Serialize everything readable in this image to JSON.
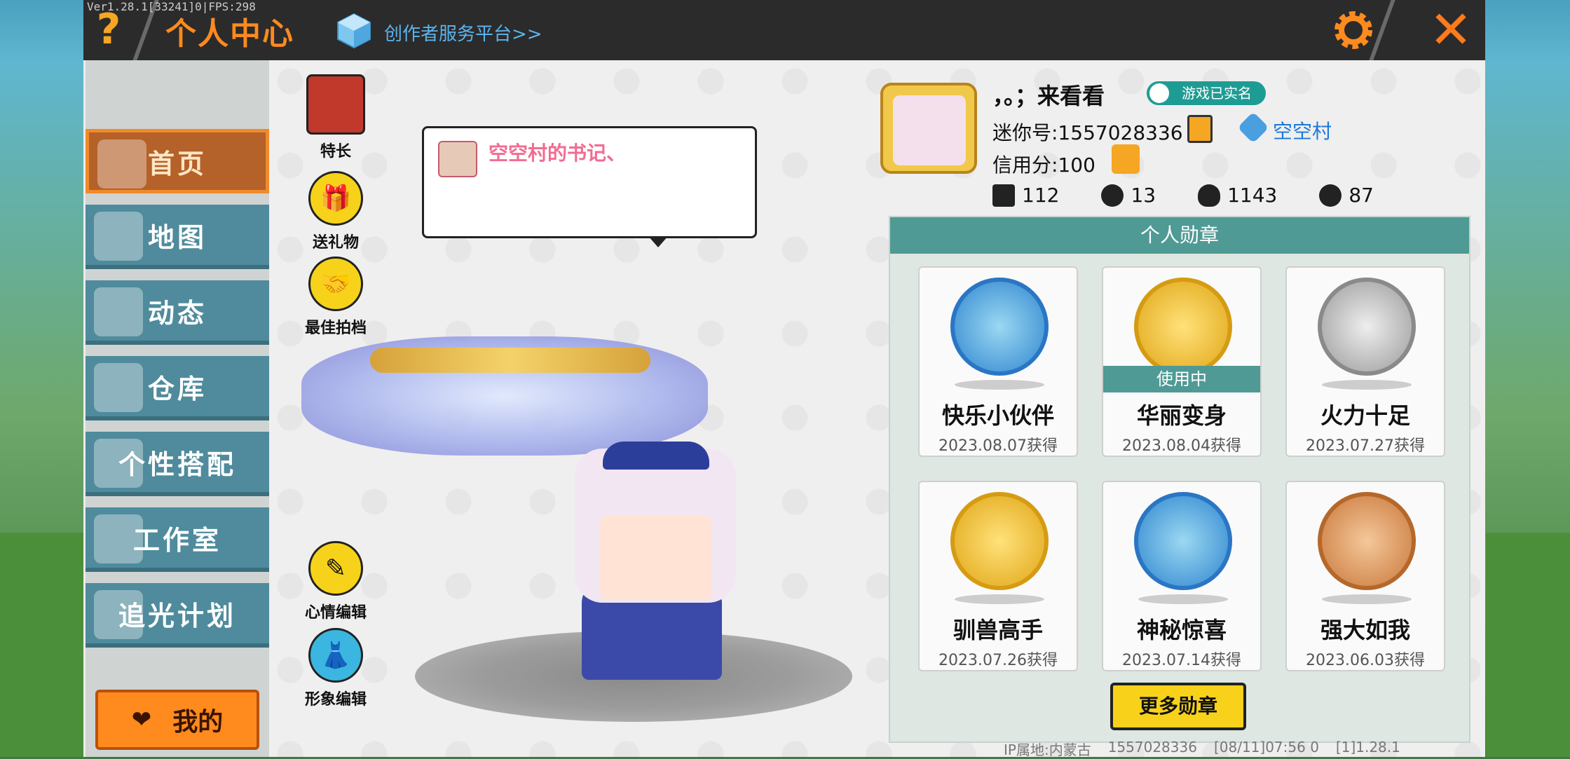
{
  "version_text": "Ver1.28.1[33241]0|FPS:298",
  "header": {
    "help_label": "?",
    "title": "个人中心",
    "creator_link": "创作者服务平台>>",
    "close_label": "✕"
  },
  "nav": {
    "items": [
      {
        "label": "首页",
        "active": true
      },
      {
        "label": "地图"
      },
      {
        "label": "动态"
      },
      {
        "label": "仓库"
      },
      {
        "label": "个性搭配"
      },
      {
        "label": "工作室"
      },
      {
        "label": "追光计划"
      }
    ],
    "mine_label": "我的"
  },
  "side_buttons": {
    "specialty": "特长",
    "gift": "送礼物",
    "partner": "最佳拍档",
    "mood_edit": "心情编辑",
    "image_edit": "形象编辑"
  },
  "bubble": {
    "text": "空空村的书记、"
  },
  "profile": {
    "name": "，。；来看看",
    "verified": "游戏已实名",
    "mini_id": "迷你号:1557028336",
    "village": "空空村",
    "credit": "信用分:100",
    "stats": {
      "likes": "112",
      "fans": "13",
      "hot": "1143",
      "hearts": "87"
    }
  },
  "medals": {
    "title": "个人勋章",
    "in_use_label": "使用中",
    "items": [
      {
        "name": "快乐小伙伴",
        "date": "2023.08.07获得"
      },
      {
        "name": "华丽变身",
        "date": "2023.08.04获得"
      },
      {
        "name": "火力十足",
        "date": "2023.07.27获得"
      },
      {
        "name": "驯兽高手",
        "date": "2023.07.26获得"
      },
      {
        "name": "神秘惊喜",
        "date": "2023.07.14获得"
      },
      {
        "name": "强大如我",
        "date": "2023.06.03获得"
      }
    ],
    "more_label": "更多勋章"
  },
  "footer": {
    "ip": "IP属地:内蒙古",
    "id": "1557028336",
    "time": "[08/11]07:56 0",
    "build": "[1]1.28.1"
  },
  "colors": {
    "accent": "#ff8a1e",
    "nav_blue": "#4f8b9c",
    "teal": "#4f9a94",
    "yellow": "#f8d21a"
  }
}
